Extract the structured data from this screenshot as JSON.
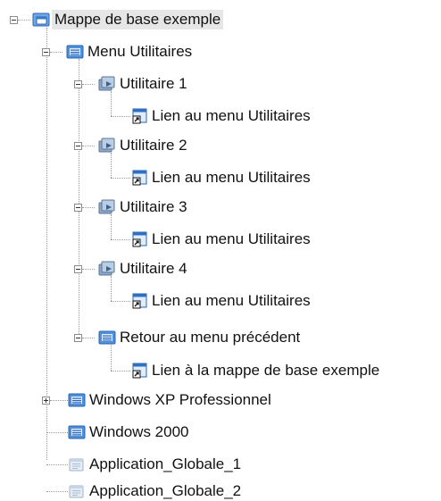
{
  "tree": {
    "items": [
      {
        "label": "Mappe de base exemple",
        "icon": "map-icon",
        "toggle": "minus"
      },
      {
        "label": "Menu Utilitaires",
        "icon": "menu-icon",
        "toggle": "minus"
      },
      {
        "label": "Utilitaire 1",
        "icon": "utility-icon",
        "toggle": "minus"
      },
      {
        "label": "Lien au menu Utilitaires",
        "icon": "shortcut-icon",
        "toggle": ""
      },
      {
        "label": "Utilitaire 2",
        "icon": "utility-icon",
        "toggle": "minus"
      },
      {
        "label": "Lien au menu Utilitaires",
        "icon": "shortcut-icon",
        "toggle": ""
      },
      {
        "label": "Utilitaire 3",
        "icon": "utility-icon",
        "toggle": "minus"
      },
      {
        "label": "Lien au menu Utilitaires",
        "icon": "shortcut-icon",
        "toggle": ""
      },
      {
        "label": "Utilitaire 4",
        "icon": "utility-icon",
        "toggle": "minus"
      },
      {
        "label": "Lien au menu Utilitaires",
        "icon": "shortcut-icon",
        "toggle": ""
      },
      {
        "label": "Retour au menu précédent",
        "icon": "menu-icon",
        "toggle": "minus"
      },
      {
        "label": "Lien à la mappe de base exemple",
        "icon": "shortcut-icon",
        "toggle": ""
      },
      {
        "label": "Windows XP Professionnel",
        "icon": "menu-icon",
        "toggle": "plus"
      },
      {
        "label": "Windows 2000",
        "icon": "menu-icon",
        "toggle": ""
      },
      {
        "label": "Application_Globale_1",
        "icon": "application-icon",
        "toggle": ""
      },
      {
        "label": "Application_Globale_2",
        "icon": "application-icon",
        "toggle": ""
      }
    ]
  },
  "colors": {
    "selection_bg": "#e6e6e6",
    "icon_blue": "#3a78c4",
    "connector": "#9a9a9a"
  }
}
